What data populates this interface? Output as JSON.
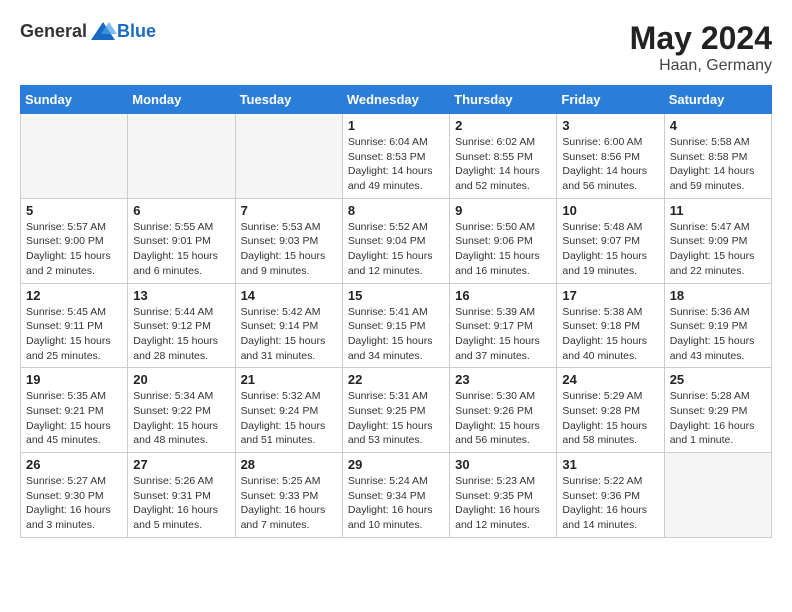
{
  "header": {
    "logo_general": "General",
    "logo_blue": "Blue",
    "month_year": "May 2024",
    "location": "Haan, Germany"
  },
  "days_of_week": [
    "Sunday",
    "Monday",
    "Tuesday",
    "Wednesday",
    "Thursday",
    "Friday",
    "Saturday"
  ],
  "weeks": [
    [
      {
        "day": "",
        "info": "",
        "empty": true
      },
      {
        "day": "",
        "info": "",
        "empty": true
      },
      {
        "day": "",
        "info": "",
        "empty": true
      },
      {
        "day": "1",
        "sunrise": "Sunrise: 6:04 AM",
        "sunset": "Sunset: 8:53 PM",
        "daylight": "Daylight: 14 hours and 49 minutes."
      },
      {
        "day": "2",
        "sunrise": "Sunrise: 6:02 AM",
        "sunset": "Sunset: 8:55 PM",
        "daylight": "Daylight: 14 hours and 52 minutes."
      },
      {
        "day": "3",
        "sunrise": "Sunrise: 6:00 AM",
        "sunset": "Sunset: 8:56 PM",
        "daylight": "Daylight: 14 hours and 56 minutes."
      },
      {
        "day": "4",
        "sunrise": "Sunrise: 5:58 AM",
        "sunset": "Sunset: 8:58 PM",
        "daylight": "Daylight: 14 hours and 59 minutes."
      }
    ],
    [
      {
        "day": "5",
        "sunrise": "Sunrise: 5:57 AM",
        "sunset": "Sunset: 9:00 PM",
        "daylight": "Daylight: 15 hours and 2 minutes."
      },
      {
        "day": "6",
        "sunrise": "Sunrise: 5:55 AM",
        "sunset": "Sunset: 9:01 PM",
        "daylight": "Daylight: 15 hours and 6 minutes."
      },
      {
        "day": "7",
        "sunrise": "Sunrise: 5:53 AM",
        "sunset": "Sunset: 9:03 PM",
        "daylight": "Daylight: 15 hours and 9 minutes."
      },
      {
        "day": "8",
        "sunrise": "Sunrise: 5:52 AM",
        "sunset": "Sunset: 9:04 PM",
        "daylight": "Daylight: 15 hours and 12 minutes."
      },
      {
        "day": "9",
        "sunrise": "Sunrise: 5:50 AM",
        "sunset": "Sunset: 9:06 PM",
        "daylight": "Daylight: 15 hours and 16 minutes."
      },
      {
        "day": "10",
        "sunrise": "Sunrise: 5:48 AM",
        "sunset": "Sunset: 9:07 PM",
        "daylight": "Daylight: 15 hours and 19 minutes."
      },
      {
        "day": "11",
        "sunrise": "Sunrise: 5:47 AM",
        "sunset": "Sunset: 9:09 PM",
        "daylight": "Daylight: 15 hours and 22 minutes."
      }
    ],
    [
      {
        "day": "12",
        "sunrise": "Sunrise: 5:45 AM",
        "sunset": "Sunset: 9:11 PM",
        "daylight": "Daylight: 15 hours and 25 minutes."
      },
      {
        "day": "13",
        "sunrise": "Sunrise: 5:44 AM",
        "sunset": "Sunset: 9:12 PM",
        "daylight": "Daylight: 15 hours and 28 minutes."
      },
      {
        "day": "14",
        "sunrise": "Sunrise: 5:42 AM",
        "sunset": "Sunset: 9:14 PM",
        "daylight": "Daylight: 15 hours and 31 minutes."
      },
      {
        "day": "15",
        "sunrise": "Sunrise: 5:41 AM",
        "sunset": "Sunset: 9:15 PM",
        "daylight": "Daylight: 15 hours and 34 minutes."
      },
      {
        "day": "16",
        "sunrise": "Sunrise: 5:39 AM",
        "sunset": "Sunset: 9:17 PM",
        "daylight": "Daylight: 15 hours and 37 minutes."
      },
      {
        "day": "17",
        "sunrise": "Sunrise: 5:38 AM",
        "sunset": "Sunset: 9:18 PM",
        "daylight": "Daylight: 15 hours and 40 minutes."
      },
      {
        "day": "18",
        "sunrise": "Sunrise: 5:36 AM",
        "sunset": "Sunset: 9:19 PM",
        "daylight": "Daylight: 15 hours and 43 minutes."
      }
    ],
    [
      {
        "day": "19",
        "sunrise": "Sunrise: 5:35 AM",
        "sunset": "Sunset: 9:21 PM",
        "daylight": "Daylight: 15 hours and 45 minutes."
      },
      {
        "day": "20",
        "sunrise": "Sunrise: 5:34 AM",
        "sunset": "Sunset: 9:22 PM",
        "daylight": "Daylight: 15 hours and 48 minutes."
      },
      {
        "day": "21",
        "sunrise": "Sunrise: 5:32 AM",
        "sunset": "Sunset: 9:24 PM",
        "daylight": "Daylight: 15 hours and 51 minutes."
      },
      {
        "day": "22",
        "sunrise": "Sunrise: 5:31 AM",
        "sunset": "Sunset: 9:25 PM",
        "daylight": "Daylight: 15 hours and 53 minutes."
      },
      {
        "day": "23",
        "sunrise": "Sunrise: 5:30 AM",
        "sunset": "Sunset: 9:26 PM",
        "daylight": "Daylight: 15 hours and 56 minutes."
      },
      {
        "day": "24",
        "sunrise": "Sunrise: 5:29 AM",
        "sunset": "Sunset: 9:28 PM",
        "daylight": "Daylight: 15 hours and 58 minutes."
      },
      {
        "day": "25",
        "sunrise": "Sunrise: 5:28 AM",
        "sunset": "Sunset: 9:29 PM",
        "daylight": "Daylight: 16 hours and 1 minute."
      }
    ],
    [
      {
        "day": "26",
        "sunrise": "Sunrise: 5:27 AM",
        "sunset": "Sunset: 9:30 PM",
        "daylight": "Daylight: 16 hours and 3 minutes."
      },
      {
        "day": "27",
        "sunrise": "Sunrise: 5:26 AM",
        "sunset": "Sunset: 9:31 PM",
        "daylight": "Daylight: 16 hours and 5 minutes."
      },
      {
        "day": "28",
        "sunrise": "Sunrise: 5:25 AM",
        "sunset": "Sunset: 9:33 PM",
        "daylight": "Daylight: 16 hours and 7 minutes."
      },
      {
        "day": "29",
        "sunrise": "Sunrise: 5:24 AM",
        "sunset": "Sunset: 9:34 PM",
        "daylight": "Daylight: 16 hours and 10 minutes."
      },
      {
        "day": "30",
        "sunrise": "Sunrise: 5:23 AM",
        "sunset": "Sunset: 9:35 PM",
        "daylight": "Daylight: 16 hours and 12 minutes."
      },
      {
        "day": "31",
        "sunrise": "Sunrise: 5:22 AM",
        "sunset": "Sunset: 9:36 PM",
        "daylight": "Daylight: 16 hours and 14 minutes."
      },
      {
        "day": "",
        "info": "",
        "empty": true
      }
    ]
  ]
}
